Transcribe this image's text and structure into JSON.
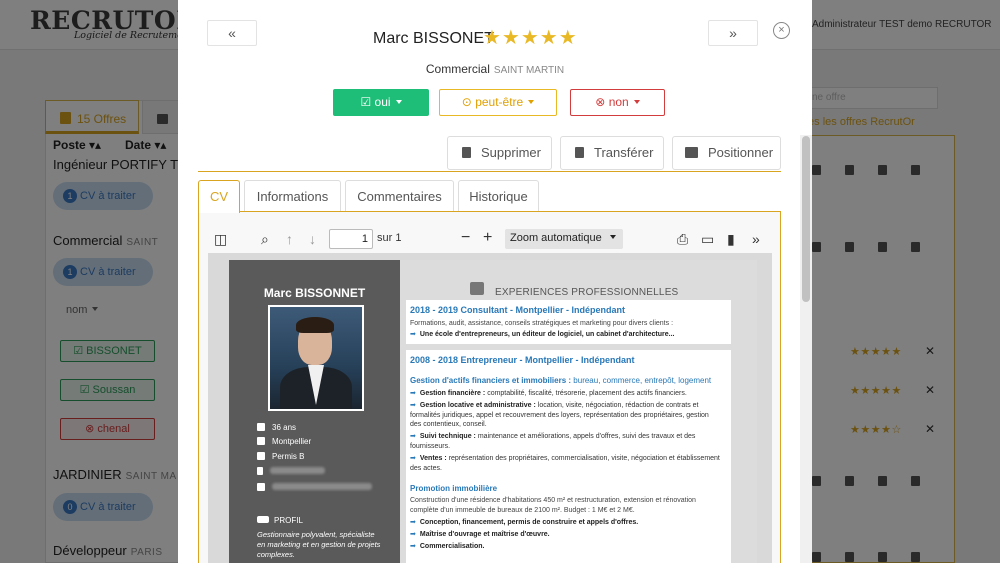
{
  "app": {
    "logo": "RECRUTOR",
    "logo_tagline": "Logiciel de Recrutement",
    "admin_label": "Administrateur TEST demo RECRUTOR"
  },
  "background": {
    "offers_tab_label": "15 Offres",
    "columns": [
      "Poste",
      "Date"
    ],
    "jobs": [
      {
        "title": "Ingénieur PORTIFY TE",
        "city": "",
        "cv_count": "1",
        "cv_label": "CV à traiter"
      },
      {
        "title": "Commercial",
        "city": "SAINT",
        "cv_count": "1",
        "cv_label": "CV à traiter"
      },
      {
        "title": "JARDINIER",
        "city": "SAINT MA",
        "cv_count": "0",
        "cv_label": "CV à traiter"
      },
      {
        "title": "Développeur",
        "city": "PARIS",
        "cv_count": "",
        "cv_label": ""
      }
    ],
    "name_filter": "nom",
    "candidates": [
      {
        "name": "BISSONET",
        "status": "green"
      },
      {
        "name": "Soussan",
        "status": "green"
      },
      {
        "name": "chenal",
        "status": "red"
      }
    ],
    "search_placeholder": "ne offre",
    "all_offers_link": "tes les offres RecrutOr"
  },
  "modal": {
    "prev_label": "«",
    "next_label": "»",
    "close_label": "×",
    "candidate_name": "Marc BISSONET",
    "rating": 5,
    "stars_text": "★★★★★",
    "job_title": "Commercial",
    "job_city": "SAINT MARTIN",
    "decisions": [
      {
        "label": "oui",
        "icon": "☑"
      },
      {
        "label": "peut-être",
        "icon": "⊙"
      },
      {
        "label": "non",
        "icon": "⊗"
      }
    ],
    "actions": [
      {
        "label": "Supprimer",
        "icon": "trash-icon"
      },
      {
        "label": "Transférer",
        "icon": "forward-icon"
      },
      {
        "label": "Positionner",
        "icon": "users-icon"
      }
    ],
    "tabs": [
      "CV",
      "Informations",
      "Commentaires",
      "Historique"
    ],
    "active_tab": "CV"
  },
  "pdf_viewer": {
    "page_number": "1",
    "page_total_label": "sur 1",
    "zoom_label": "Zoom automatique"
  },
  "cv": {
    "name": "Marc BISSONNET",
    "age": "36 ans",
    "city": "Montpellier",
    "license": "Permis B",
    "profil_label": "PROFIL",
    "profil_text": "Gestionnaire polyvalent, spécialiste en marketing et en gestion de projets complexes.",
    "section_title": "EXPERIENCES PROFESSIONNELLES",
    "exp1": {
      "title": "2018 - 2019   Consultant - Montpellier - Indépendant",
      "desc": "Formations, audit, assistance, conseils stratégiques et marketing pour divers clients :",
      "bullet": "Une école d'entrepreneurs, un éditeur de logiciel, un cabinet d'architecture..."
    },
    "exp2": {
      "title": "2008 - 2018   Entrepreneur - Montpellier - Indépendant",
      "sub1_bold": "Gestion d'actifs financiers et immobiliers :",
      "sub1_rest": "bureau, commerce, entrepôt, logement",
      "bullets": [
        {
          "bold": "Gestion financière :",
          "text": "comptabilité, fiscalité, trésorerie, placement des actifs financiers."
        },
        {
          "bold": "Gestion locative et administrative :",
          "text": "location, visite, négociation, rédaction de contrats et formalités juridiques, appel et recouvrement des loyers, représentation des propriétaires, gestion des contentieux, conseil."
        },
        {
          "bold": "Suivi technique :",
          "text": "maintenance et améliorations, appels d'offres, suivi des travaux et des fournisseurs."
        },
        {
          "bold": "Ventes :",
          "text": "représentation des propriétaires, commercialisation, visite, négociation et établissement des actes."
        }
      ],
      "sub2": "Promotion immobilière",
      "sub2_text": "Construction d'une résidence d'habitations 450 m² et restructuration, extension et rénovation complète d'un immeuble de bureaux de 2100 m². Budget : 1 M€ et 2 M€.",
      "bullets2": [
        "Conception, financement, permis de construire et appels d'offres.",
        "Maîtrise d'ouvrage et maîtrise d'œuvre.",
        "Commercialisation."
      ]
    }
  },
  "colors": {
    "accent": "#d9a521",
    "success": "#1ebe78",
    "warning": "#e9b825",
    "danger": "#d23c3c",
    "link": "#2979b8"
  }
}
